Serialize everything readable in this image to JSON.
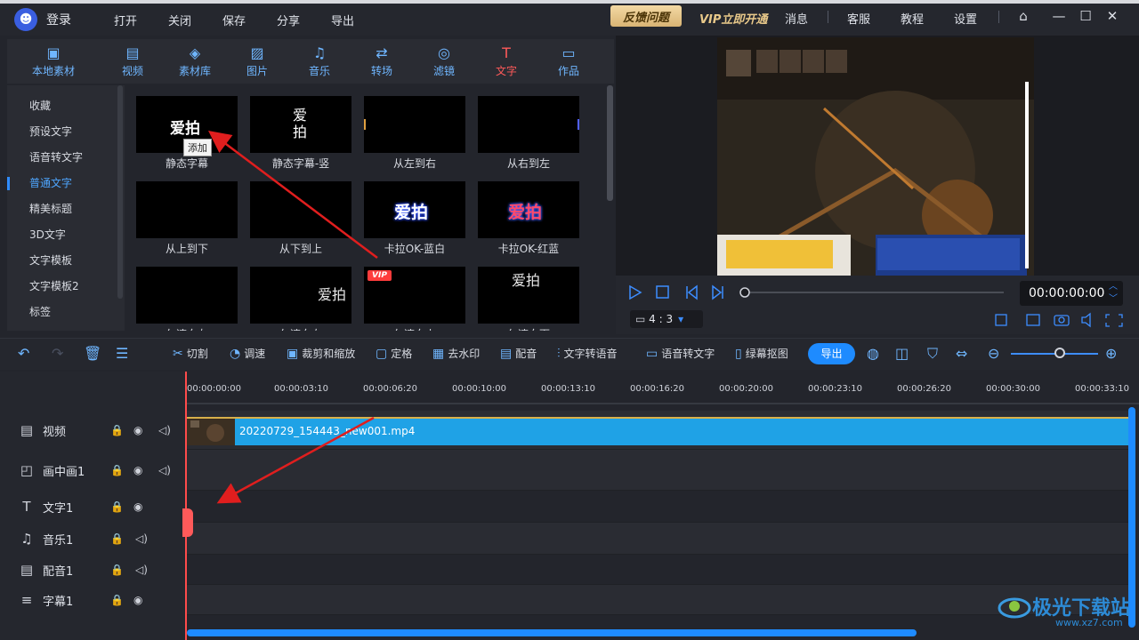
{
  "titlebar": {
    "login": "登录",
    "menu": [
      "打开",
      "关闭",
      "保存",
      "分享",
      "导出"
    ],
    "feedback": "反馈问题",
    "vip_open": "VIP立即开通",
    "messages": "消息",
    "service": "客服",
    "tutorial": "教程",
    "settings": "设置"
  },
  "tools": [
    {
      "icon": "folder-icon",
      "label": "本地素材"
    },
    {
      "icon": "film-icon",
      "label": "视频"
    },
    {
      "icon": "library-icon",
      "label": "素材库"
    },
    {
      "icon": "image-icon",
      "label": "图片"
    },
    {
      "icon": "music-icon",
      "label": "音乐"
    },
    {
      "icon": "transition-icon",
      "label": "转场"
    },
    {
      "icon": "filter-icon",
      "label": "滤镜"
    },
    {
      "icon": "text-icon",
      "label": "文字"
    },
    {
      "icon": "works-icon",
      "label": "作品"
    }
  ],
  "categories": [
    "收藏",
    "预设文字",
    "语音转文字",
    "普通文字",
    "精美标题",
    "3D文字",
    "文字模板",
    "文字模板2",
    "标签"
  ],
  "active_category": "普通文字",
  "templates": [
    {
      "label": "静态字幕",
      "preview": "爱拍"
    },
    {
      "label": "静态字幕-竖",
      "preview": "爱拍"
    },
    {
      "label": "从左到右",
      "preview": ""
    },
    {
      "label": "从右到左",
      "preview": ""
    },
    {
      "label": "从上到下",
      "preview": ""
    },
    {
      "label": "从下到上",
      "preview": ""
    },
    {
      "label": "卡拉OK-蓝白",
      "preview": "爱拍"
    },
    {
      "label": "卡拉OK-红蓝",
      "preview": "爱拍"
    },
    {
      "label": "匀速向左",
      "preview": ""
    },
    {
      "label": "匀速向右",
      "preview": "爱拍"
    },
    {
      "label": "匀速向上",
      "preview": ""
    },
    {
      "label": "匀速向下",
      "preview": "爱拍"
    }
  ],
  "tooltip": "添加",
  "vip_badge": "VIP",
  "preview": {
    "time": "00:00:00:00",
    "ratio": "4 : 3"
  },
  "edit_bar": {
    "cut": "切割",
    "speed": "调速",
    "crop": "裁剪和缩放",
    "freeze": "定格",
    "watermark": "去水印",
    "dub": "配音",
    "tts": "文字转语音",
    "stt": "语音转文字",
    "chroma": "绿幕抠图",
    "export": "导出"
  },
  "ruler": [
    "00:00:00:00",
    "00:00:03:10",
    "00:00:06:20",
    "00:00:10:00",
    "00:00:13:10",
    "00:00:16:20",
    "00:00:20:00",
    "00:00:23:10",
    "00:00:26:20",
    "00:00:30:00",
    "00:00:33:10"
  ],
  "tracks": [
    {
      "icon": "film-icon",
      "name": "视频"
    },
    {
      "icon": "pip-icon",
      "name": "画中画1"
    },
    {
      "icon": "text-icon",
      "name": "文字1"
    },
    {
      "icon": "music-icon",
      "name": "音乐1"
    },
    {
      "icon": "dub-icon",
      "name": "配音1"
    },
    {
      "icon": "subtitle-icon",
      "name": "字幕1"
    }
  ],
  "clip": {
    "name": "20220729_154443_new001.mp4"
  },
  "watermark": {
    "text": "极光下载站",
    "url": "www.xz7.com"
  },
  "colors": {
    "accent": "#1e8bff",
    "active_tool": "#ff5a5a",
    "clip": "#1fa2e6"
  }
}
